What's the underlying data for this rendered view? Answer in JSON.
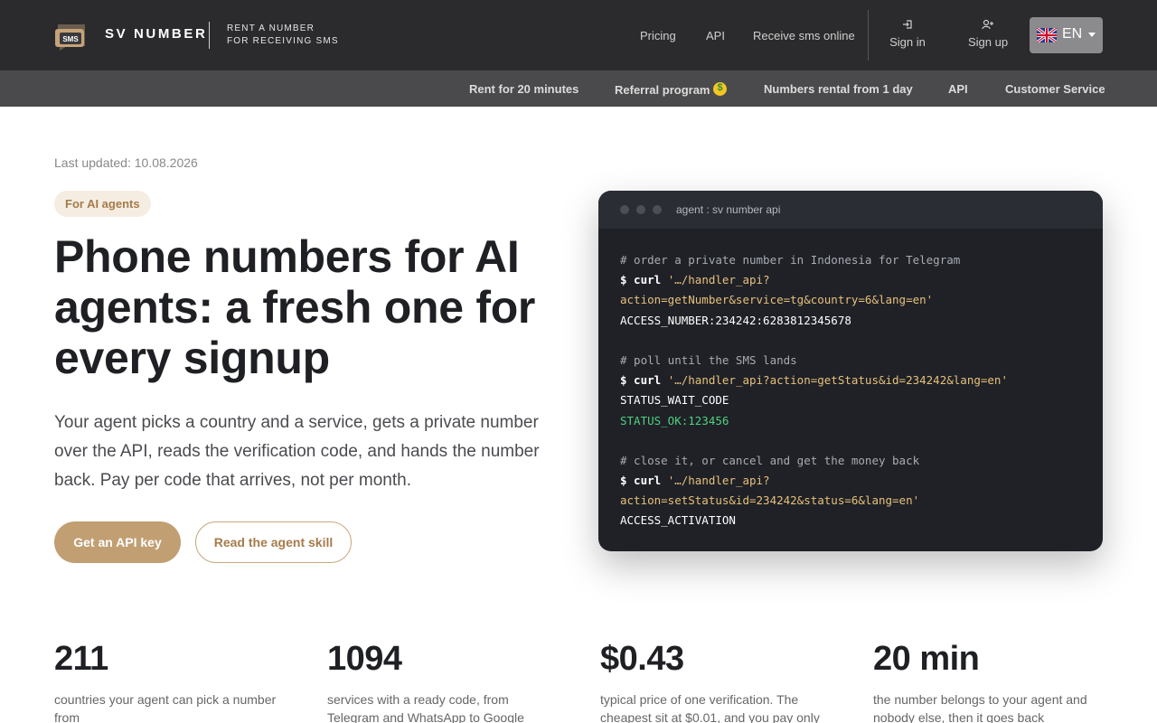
{
  "header": {
    "logo_text": "SMS",
    "brand": "SV NUMBER",
    "tagline_1": "RENT A NUMBER",
    "tagline_2": "FOR RECEIVING SMS",
    "nav": [
      "Pricing",
      "API",
      "Receive sms online"
    ],
    "sign_in": "Sign in",
    "sign_up": "Sign up",
    "language": "EN"
  },
  "subnav": [
    "Rent for 20 minutes",
    "Referral program",
    "Numbers rental from 1 day",
    "API",
    "Customer Service"
  ],
  "hero": {
    "last_updated": "Last updated: 10.08.2026",
    "pill": "For AI agents",
    "title": "Phone numbers for AI agents: a fresh one for every signup",
    "text": "Your agent picks a country and a service, gets a private number over the API, reads the verification code, and hands the number back. Pay per code that arrives, not per month.",
    "primary_button": "Get an API key",
    "secondary_button": "Read the agent skill"
  },
  "terminal": {
    "title": "agent : sv number api",
    "lines": [
      {
        "kind": "comment",
        "text": "# order a private number in Indonesia for Telegram"
      },
      {
        "kind": "cmd",
        "prompt": "$ curl ",
        "text": "'…/handler_api?"
      },
      {
        "kind": "str",
        "text": "action=getNumber&service=tg&country=6&lang=en'"
      },
      {
        "kind": "out",
        "text": "ACCESS_NUMBER:234242:6283812345678"
      },
      {
        "kind": "blank",
        "text": ""
      },
      {
        "kind": "comment",
        "text": "# poll until the SMS lands"
      },
      {
        "kind": "cmd",
        "prompt": "$ curl ",
        "text": "'…/handler_api?action=getStatus&id=234242&lang=en'"
      },
      {
        "kind": "out",
        "text": "STATUS_WAIT_CODE"
      },
      {
        "kind": "ok",
        "text": "STATUS_OK:123456"
      },
      {
        "kind": "blank",
        "text": ""
      },
      {
        "kind": "comment",
        "text": "# close it, or cancel and get the money back"
      },
      {
        "kind": "cmd",
        "prompt": "$ curl ",
        "text": "'…/handler_api?"
      },
      {
        "kind": "str",
        "text": "action=setStatus&id=234242&status=6&lang=en'"
      },
      {
        "kind": "out",
        "text": "ACCESS_ACTIVATION"
      }
    ]
  },
  "stats": [
    {
      "number": "211",
      "desc_1": "countries your agent can pick a number",
      "desc_2": "from"
    },
    {
      "number": "1094",
      "desc_1": "services with a ready code, from",
      "desc_2": "Telegram and WhatsApp to Google"
    },
    {
      "number": "$0.43",
      "desc_1": "typical price of one verification. The",
      "desc_2": "cheapest sit at $0.01, and you pay only"
    },
    {
      "number": "20 min",
      "desc_1": "the number belongs to your agent and",
      "desc_2": "nobody else, then it goes back"
    }
  ],
  "colors": {
    "header_bg": "#2b2b2d",
    "subnav_bg": "#4a4a4c",
    "accent": "#c19f72",
    "terminal_bg": "#1f2127",
    "ok_green": "#4fd07f"
  }
}
